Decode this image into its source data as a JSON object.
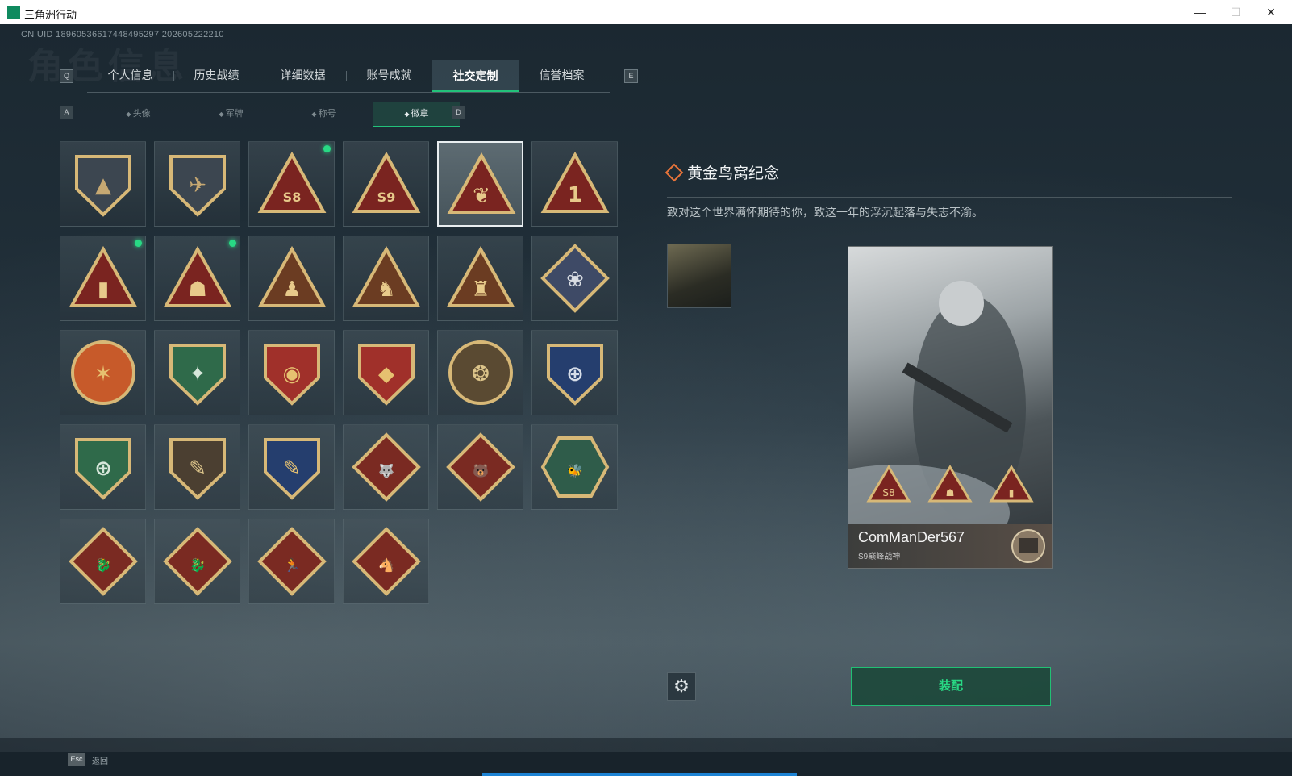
{
  "window": {
    "title": "三角洲行动",
    "minimize": "—",
    "maximize": "☐",
    "close": "✕"
  },
  "uid_text": "CN UID 18960536617448495297 202605222210",
  "watermark": "角色信息",
  "tabs": {
    "left_key": "Q",
    "right_key": "E",
    "items": [
      {
        "label": "个人信息"
      },
      {
        "label": "历史战绩"
      },
      {
        "label": "详细数据"
      },
      {
        "label": "账号成就"
      },
      {
        "label": "社交定制",
        "active": true
      },
      {
        "label": "信誉档案"
      }
    ]
  },
  "subtabs": {
    "left_key": "A",
    "right_key": "D",
    "items": [
      {
        "label": "头像",
        "icon": "person-icon"
      },
      {
        "label": "军牌",
        "icon": "dogtag-icon"
      },
      {
        "label": "称号",
        "icon": "title-icon"
      },
      {
        "label": "徽章",
        "icon": "badge-icon",
        "active": true
      }
    ]
  },
  "badges": [
    {
      "shape": "shield",
      "bg": "#3c4650",
      "fg": "#c6a872",
      "glyph": "▲"
    },
    {
      "shape": "shield",
      "bg": "#3c4650",
      "fg": "#c6a872",
      "glyph": "✈"
    },
    {
      "shape": "triangle",
      "bg": "#7a2420",
      "fg": "#e7c98a",
      "glyph": "S8",
      "new": true
    },
    {
      "shape": "triangle",
      "bg": "#7a2420",
      "fg": "#e7c98a",
      "glyph": "S9"
    },
    {
      "shape": "triangle",
      "bg": "#7a2420",
      "fg": "#e7c98a",
      "glyph": "❦",
      "selected": true
    },
    {
      "shape": "triangle",
      "bg": "#7a2420",
      "fg": "#e7c98a",
      "glyph": "1"
    },
    {
      "shape": "triangle",
      "bg": "#7a2420",
      "fg": "#e7c98a",
      "glyph": "▮",
      "new": true
    },
    {
      "shape": "triangle",
      "bg": "#7a2420",
      "fg": "#e7c98a",
      "glyph": "☗",
      "new": true
    },
    {
      "shape": "triangle",
      "bg": "#6b3c22",
      "fg": "#e7c98a",
      "glyph": "♟"
    },
    {
      "shape": "triangle",
      "bg": "#6b3c22",
      "fg": "#e7c98a",
      "glyph": "♞"
    },
    {
      "shape": "triangle",
      "bg": "#6b3c22",
      "fg": "#e7c98a",
      "glyph": "♜"
    },
    {
      "shape": "diamond",
      "bg": "#3e4a66",
      "fg": "#d9dde3",
      "glyph": "❀"
    },
    {
      "shape": "circle",
      "bg": "#c75a2a",
      "fg": "#e6c170",
      "glyph": "✶"
    },
    {
      "shape": "shield",
      "bg": "#2f6a4a",
      "fg": "#d6e6da",
      "glyph": "✦"
    },
    {
      "shape": "shield",
      "bg": "#a0302a",
      "fg": "#e6c170",
      "glyph": "◉"
    },
    {
      "shape": "shield",
      "bg": "#a0302a",
      "fg": "#e6c170",
      "glyph": "◆"
    },
    {
      "shape": "circle",
      "bg": "#5a4a32",
      "fg": "#dcc48a",
      "glyph": "❂"
    },
    {
      "shape": "shield",
      "bg": "#253e6e",
      "fg": "#d6dde8",
      "glyph": "⊕"
    },
    {
      "shape": "shield",
      "bg": "#2f6a4a",
      "fg": "#d6e6da",
      "glyph": "⊕"
    },
    {
      "shape": "shield",
      "bg": "#4b3f31",
      "fg": "#dcc48a",
      "glyph": "✎"
    },
    {
      "shape": "shield",
      "bg": "#253e6e",
      "fg": "#e6c170",
      "glyph": "✎"
    },
    {
      "shape": "diamond",
      "bg": "#7a2a22",
      "fg": "#e7c98a",
      "glyph": "🐺"
    },
    {
      "shape": "diamond",
      "bg": "#7a2a22",
      "fg": "#e7c98a",
      "glyph": "🐻"
    },
    {
      "shape": "hexagon",
      "bg": "#2f5c4a",
      "fg": "#e7c98a",
      "glyph": "🐝"
    },
    {
      "shape": "diamond",
      "bg": "#7a2a22",
      "fg": "#e7c98a",
      "glyph": "🐉"
    },
    {
      "shape": "diamond",
      "bg": "#7a2a22",
      "fg": "#e7c98a",
      "glyph": "🐉"
    },
    {
      "shape": "diamond",
      "bg": "#7a2a22",
      "fg": "#e7c98a",
      "glyph": "🏃"
    },
    {
      "shape": "diamond",
      "bg": "#7a2a22",
      "fg": "#e7c98a",
      "glyph": "🐴"
    }
  ],
  "detail": {
    "title": "黄金鸟窝纪念",
    "description": "致对这个世界满怀期待的你，致这一年的浮沉起落与失志不渝。",
    "card_name": "ComManDer567",
    "card_subtitle": "S9巅峰战神",
    "card_badges": [
      "S8",
      "☗",
      "▮"
    ]
  },
  "actions": {
    "settings_icon": "⚙",
    "equip_label": "装配"
  },
  "footer": {
    "esc_key": "Esc",
    "esc_label": "返回"
  },
  "colors": {
    "accent": "#22c27a",
    "accent_text": "#28d984",
    "detail_diamond": "#e8743a"
  }
}
